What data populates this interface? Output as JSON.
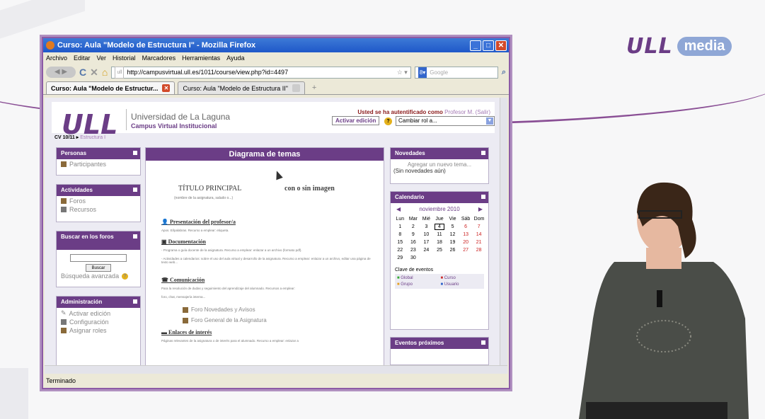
{
  "branding": {
    "logo_main": "ULL",
    "logo_media": "media"
  },
  "window": {
    "title": "Curso: Aula \"Modelo de Estructura I\" - Mozilla Firefox"
  },
  "menu": [
    "Archivo",
    "Editar",
    "Ver",
    "Historial",
    "Marcadores",
    "Herramientas",
    "Ayuda"
  ],
  "url": "http://campusvirtual.ull.es/1011/course/view.php?id=4497",
  "search_placeholder": "Google",
  "tabs": [
    {
      "label": "Curso: Aula \"Modelo de Estructur..."
    },
    {
      "label": "Curso: Aula \"Modelo de Estructura II\""
    }
  ],
  "header": {
    "logo": "ULL",
    "university": "Universidad de La Laguna",
    "campus": "Campus Virtual Institucional",
    "auth_text": "Usted se ha autentificado como",
    "auth_user": "Profesor M.",
    "auth_exit": "(Salir)",
    "edit_button": "Activar edición",
    "role_select": "Cambiar rol a..."
  },
  "breadcrumb": {
    "root": "CV 10/11",
    "current": "Estructura I"
  },
  "left_blocks": {
    "personas": {
      "title": "Personas",
      "items": [
        "Participantes"
      ]
    },
    "actividades": {
      "title": "Actividades",
      "items": [
        "Foros",
        "Recursos"
      ]
    },
    "buscar": {
      "title": "Buscar en los foros",
      "button": "Buscar",
      "advanced": "Búsqueda avanzada"
    },
    "admin": {
      "title": "Administración",
      "items": [
        "Activar edición",
        "Configuración",
        "Asignar roles"
      ]
    }
  },
  "main": {
    "title": "Diagrama de temas",
    "principal": "TÍTULO PRINCIPAL",
    "image_opt": "con o sin imagen",
    "subtitle": "(nombre de la asignatura, saludo o...)",
    "sections": [
      {
        "title": "Presentación del profesor/a",
        "lines": [
          "Apos. El/palabras. Recurso a emplear: etiqueta."
        ]
      },
      {
        "title": "Documentación",
        "lines": [
          "- Programa o guía docente de la asignatura. Recurso a emplear: enlazar a un archivo (formato pdf).",
          "- Actividades a calendarios: sobre el uso del aula virtual y desarrollo de la asignatura. Recurso a emplear: enlazar a un archivo, editar una página de texto web..."
        ]
      },
      {
        "title": "Comunicación",
        "lines": [
          "Para la resolución de dudas y seguimiento del aprendizaje del alumnado. Recursos a emplear:",
          "foro, chat, mensajería interna..."
        ]
      },
      {
        "title": "Enlaces de interés",
        "lines": [
          "Páginas relevantes de la asignatura o de interés para el alumnado. Recurso a emplear: enlazar a"
        ]
      }
    ],
    "forums": [
      "Foro Novedades y Avisos",
      "Foro General de la Asignatura"
    ]
  },
  "right_blocks": {
    "novedades": {
      "title": "Novedades",
      "add": "Agregar un nuevo tema...",
      "empty": "(Sin novedades aún)"
    },
    "calendario": {
      "title": "Calendario",
      "month": "noviembre 2010",
      "days": [
        "Lun",
        "Mar",
        "Mié",
        "Jue",
        "Vie",
        "Sáb",
        "Dom"
      ],
      "weeks": [
        [
          "1",
          "2",
          "3",
          "4",
          "5",
          "6",
          "7"
        ],
        [
          "8",
          "9",
          "10",
          "11",
          "12",
          "13",
          "14"
        ],
        [
          "15",
          "16",
          "17",
          "18",
          "19",
          "20",
          "21"
        ],
        [
          "22",
          "23",
          "24",
          "25",
          "26",
          "27",
          "28"
        ],
        [
          "29",
          "30",
          "",
          "",
          "",
          "",
          ""
        ]
      ],
      "key_title": "Clave de eventos",
      "keys": [
        "Global",
        "Curso",
        "Grupo",
        "Usuario"
      ]
    },
    "eventos": {
      "title": "Eventos próximos"
    }
  },
  "status": "Terminado",
  "colors": {
    "accent": "#6b3d86",
    "titlebar": "#2a63cf"
  }
}
